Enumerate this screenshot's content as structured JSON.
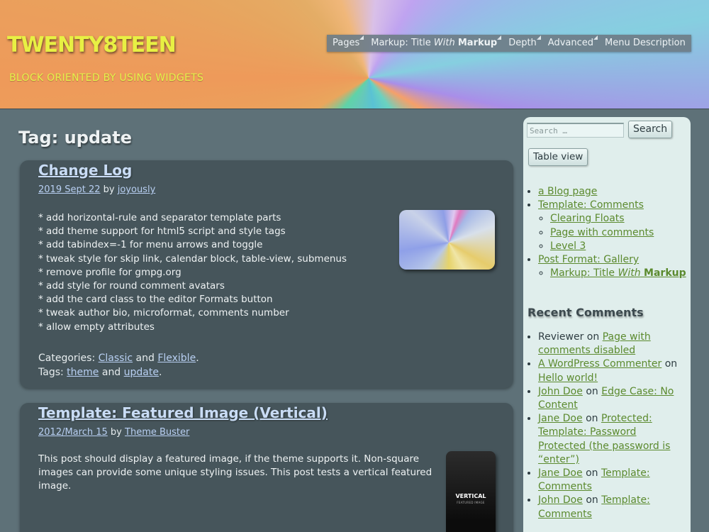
{
  "site": {
    "title": "TWENTY8TEEN",
    "tagline": "BLOCK ORIENTED BY USING WIDGETS"
  },
  "nav": {
    "items": [
      {
        "label": "Pages"
      },
      {
        "label_pre": "Markup: Title ",
        "label_em": "With",
        "label_b": "Markup"
      },
      {
        "label": "Depth"
      },
      {
        "label": "Advanced"
      },
      {
        "label": "Menu Description"
      }
    ]
  },
  "page": {
    "title": "Tag: update"
  },
  "posts": [
    {
      "title": "Change Log",
      "date": "2019 Sept 22",
      "by": "by",
      "author": "joyously",
      "body": [
        "* add horizontal-rule and separator template parts",
        "* add theme support for html5 script and style tags",
        "* add tabindex=-1 for menu arrows and toggle",
        "* tweak style for skip link, calendar block, table-view, submenus",
        "* remove profile for gmpg.org",
        "* add style for round comment avatars",
        "* add the card class to the editor Formats button",
        "* tweak author bio, microformat, comments number",
        "* allow empty attributes"
      ],
      "categories_label": "Categories:",
      "categories": [
        "Classic",
        "Flexible"
      ],
      "and": "and",
      "tags_label": "Tags:",
      "tags": [
        "theme",
        "update"
      ]
    },
    {
      "title": "Template: Featured Image (Vertical)",
      "date": "2012/March 15",
      "by": "by",
      "author": "Theme Buster",
      "body": "This post should display a featured image, if the theme supports it. Non-square images can provide some unique styling issues. This post tests a vertical featured image.",
      "thumb_text": "VERTICAL",
      "thumb_subtext": "FEATURED IMAGE"
    }
  ],
  "sidebar": {
    "search_placeholder": "Search …",
    "search_button": "Search",
    "table_view_button": "Table view",
    "pages": {
      "blog": "a Blog page",
      "comments": "Template: Comments",
      "clearing": "Clearing Floats",
      "page_comments": "Page with comments",
      "level3": "Level 3",
      "gallery": "Post Format: Gallery",
      "markup_pre": "Markup: Title ",
      "markup_em": "With",
      "markup_b": "Markup"
    },
    "recent_comments_title": "Recent Comments",
    "recent_comments": [
      {
        "author": "Reviewer",
        "author_link": false,
        "on": "on",
        "post": "Page with comments disabled"
      },
      {
        "author": "A WordPress Commenter",
        "author_link": true,
        "on": "on",
        "post": "Hello world!"
      },
      {
        "author": "John Doe",
        "author_link": true,
        "on": "on",
        "post": "Edge Case: No Content"
      },
      {
        "author": "Jane Doe",
        "author_link": true,
        "on": "on",
        "post": "Protected: Template: Password Protected (the password is “enter”)"
      },
      {
        "author": "Jane Doe",
        "author_link": true,
        "on": "on",
        "post": "Template: Comments"
      },
      {
        "author": "John Doe",
        "author_link": true,
        "on": "on",
        "post": "Template: Comments"
      }
    ]
  }
}
